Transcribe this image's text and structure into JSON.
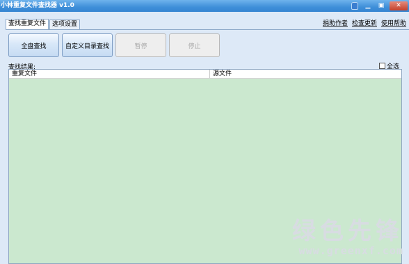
{
  "window": {
    "title": "小林重复文件查找器 v1.0",
    "controls": [
      "skin",
      "minimize",
      "maximize",
      "close"
    ]
  },
  "tabs": [
    {
      "label": "查找重复文件",
      "active": true
    },
    {
      "label": "选项设置",
      "active": false
    }
  ],
  "links": {
    "donate": "捐助作者",
    "check_update": "检查更新",
    "help": "使用帮助"
  },
  "buttons": {
    "full_scan": "全盘查找",
    "custom_dir": "自定义目录查找",
    "pause": "暂停",
    "stop": "停止"
  },
  "results": {
    "label": "查找结果:",
    "select_all": "全选",
    "columns": [
      "重复文件",
      "源文件"
    ]
  },
  "watermark": {
    "text": "绿色先锋",
    "url": "www.greenxf.com"
  },
  "colors": {
    "titlebar": "#3f8fd9",
    "client_bg": "#dde9f7",
    "list_bg": "#cbe8cf"
  }
}
